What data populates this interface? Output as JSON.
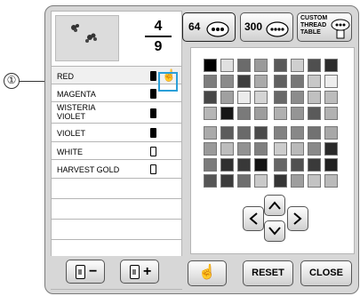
{
  "annotation": {
    "marker": "①"
  },
  "preview": {
    "current": "4",
    "total": "9"
  },
  "threads": [
    {
      "name": "RED",
      "spool": "filled",
      "selected": true
    },
    {
      "name": "MAGENTA",
      "spool": "filled"
    },
    {
      "name": "WISTERIA VIOLET",
      "spool": "filled",
      "two_line": true
    },
    {
      "name": "VIOLET",
      "spool": "filled"
    },
    {
      "name": "WHITE",
      "spool": "hollow"
    },
    {
      "name": "HARVEST GOLD",
      "spool": "hollow"
    }
  ],
  "top_buttons": {
    "btn64": "64",
    "btn300": "300",
    "custom": "CUSTOM THREAD TABLE"
  },
  "bottom": {
    "spool_minus": "−",
    "spool_plus": "+",
    "reset": "RESET",
    "close": "CLOSE"
  },
  "palette": {
    "rows": [
      [
        "#000000",
        "#e0e0e0",
        "#6b6b6b",
        "#9a9a9a",
        "#595959",
        "#cfcfcf",
        "#4f4f4f",
        "#2c2c2c"
      ],
      [
        "#7d7d7d",
        "#8b8b8b",
        "#3e3e3e",
        "#aaaaaa",
        "#606060",
        "#777777",
        "#c8c8c8",
        "#ededed"
      ],
      [
        "#464646",
        "#a0a0a0",
        "#ececec",
        "#d4d4d4",
        "#686868",
        "#8c8c8c",
        "#c0c0c0",
        "#bcbcbc"
      ],
      [
        "#b6b6b6",
        "#161616",
        "#7a7a7a",
        "#9d9d9d",
        "#b0b0b0",
        "#959595",
        "#5a5a5a",
        "#b2b2b2"
      ],
      [
        "#aaaaaa",
        "#5c5c5c",
        "#6a6a6a",
        "#4a4a4a",
        "#828282",
        "#888888",
        "#727272",
        "#a8a8a8"
      ],
      [
        "#9a9a9a",
        "#bdbdbd",
        "#929292",
        "#7f7f7f",
        "#cccccc",
        "#b9b9b9",
        "#8a8a8a",
        "#2a2a2a"
      ],
      [
        "#7b7b7b",
        "#2f2f2f",
        "#383838",
        "#111111",
        "#666666",
        "#505050",
        "#3a3a3a",
        "#202020"
      ],
      [
        "#555555",
        "#3b3b3b",
        "#6e6e6e",
        "#c9c9c9",
        "#353535",
        "#9e9e9e",
        "#c3c3c3",
        "#bababa"
      ]
    ]
  }
}
